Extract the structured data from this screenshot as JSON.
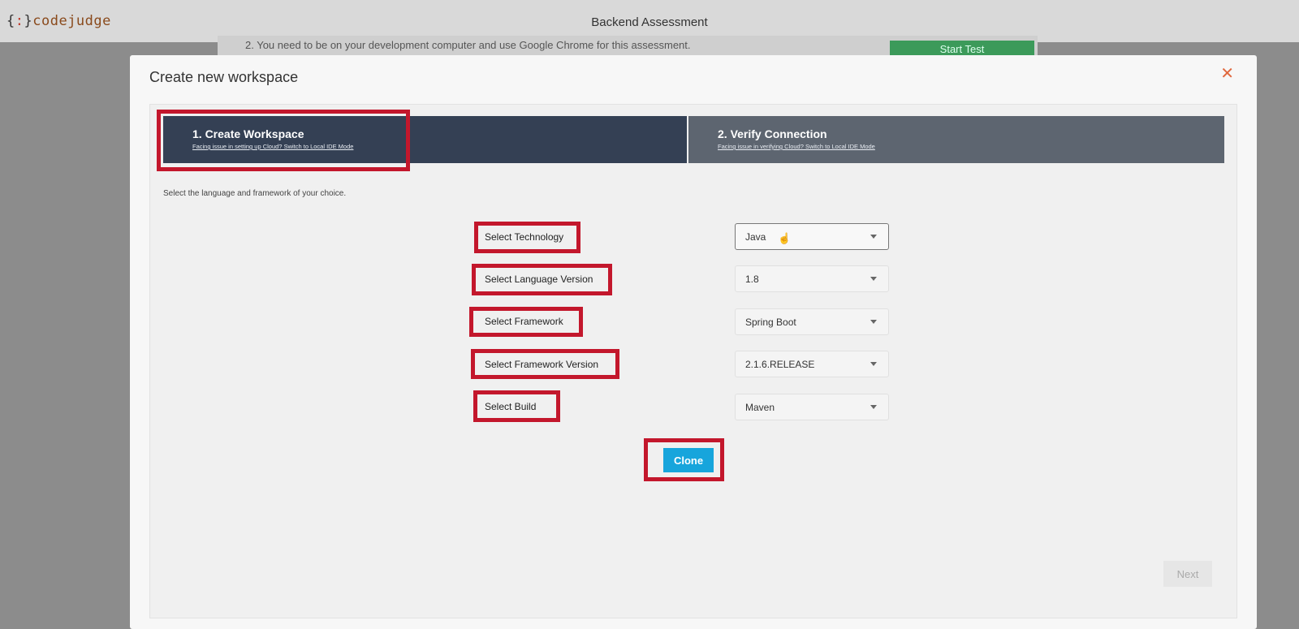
{
  "app": {
    "logo": {
      "open": "{",
      "close": "}",
      "name": "codejudge"
    },
    "title": "Backend Assessment"
  },
  "background": {
    "note": "2. You need to be on your development computer and use Google Chrome for this assessment.",
    "start_button": "Start Test"
  },
  "modal": {
    "title": "Create new workspace",
    "close_icon": "close-icon",
    "steps": [
      {
        "title": "1. Create Workspace",
        "link": "Facing issue in setting up Cloud? Switch to Local IDE Mode",
        "active": true
      },
      {
        "title": "2. Verify Connection",
        "link": "Facing issue in verifying Cloud? Switch to Local IDE Mode",
        "active": false
      }
    ],
    "instruction": "Select the language and framework of your choice.",
    "fields": [
      {
        "label": "Select Technology",
        "value": "Java"
      },
      {
        "label": "Select Language Version",
        "value": "1.8"
      },
      {
        "label": "Select Framework",
        "value": "Spring Boot"
      },
      {
        "label": "Select Framework Version",
        "value": "2.1.6.RELEASE"
      },
      {
        "label": "Select Build",
        "value": "Maven"
      }
    ],
    "clone_button": "Clone",
    "next_button": "Next"
  },
  "colors": {
    "highlight": "#c3172c",
    "step_active": "#344054",
    "step_inactive": "#5d6570",
    "clone": "#17a5dc",
    "close": "#e0683e"
  }
}
